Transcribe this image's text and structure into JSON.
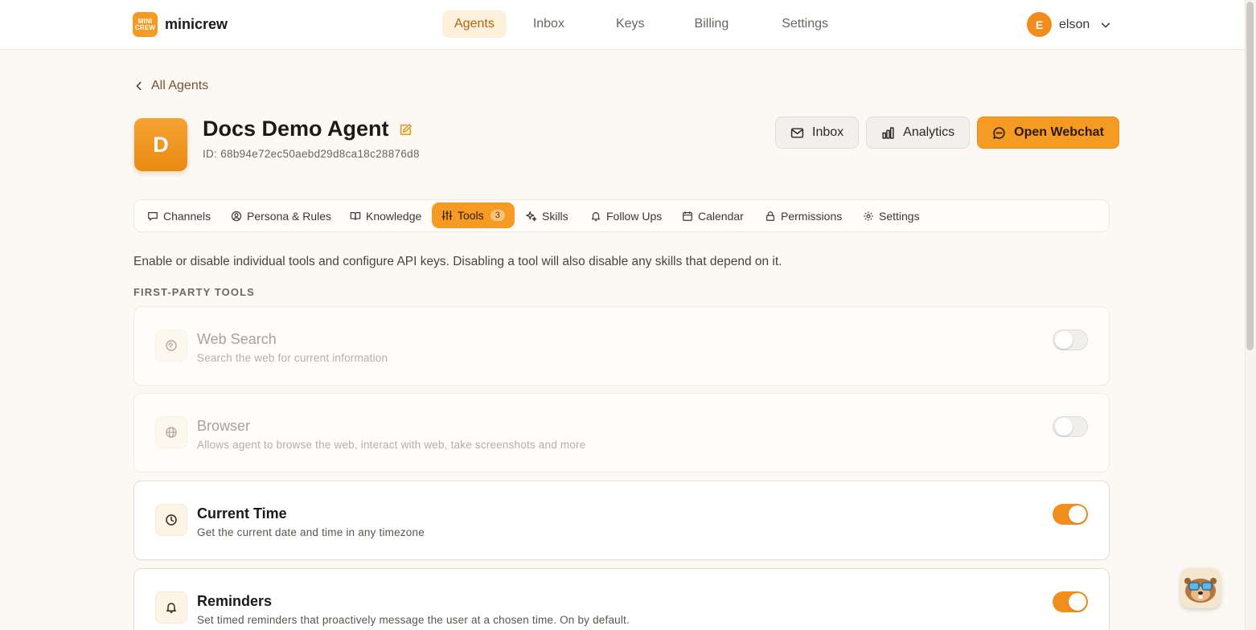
{
  "brand": {
    "logo_line1": "MINI",
    "logo_line2": "CREW",
    "name": "minicrew"
  },
  "nav": [
    {
      "label": "Agents",
      "active": true
    },
    {
      "label": "Inbox",
      "active": false
    },
    {
      "label": "Keys",
      "active": false
    },
    {
      "label": "Billing",
      "active": false
    },
    {
      "label": "Settings",
      "active": false
    }
  ],
  "user": {
    "initial": "E",
    "name": "elson"
  },
  "back_link": "All Agents",
  "agent": {
    "initial": "D",
    "name": "Docs Demo Agent",
    "id_text": "ID: 68b94e72ec50aebd29d8ca18c28876d8"
  },
  "actions": {
    "inbox": "Inbox",
    "analytics": "Analytics",
    "webchat": "Open Webchat"
  },
  "tabs": [
    {
      "label": "Channels",
      "icon": "chat-icon"
    },
    {
      "label": "Persona & Rules",
      "icon": "user-circle-icon"
    },
    {
      "label": "Knowledge",
      "icon": "book-icon"
    },
    {
      "label": "Tools",
      "icon": "sliders-icon",
      "badge": "3",
      "active": true
    },
    {
      "label": "Skills",
      "icon": "sparkle-icon"
    },
    {
      "label": "Follow Ups",
      "icon": "bell-icon"
    },
    {
      "label": "Calendar",
      "icon": "calendar-icon"
    },
    {
      "label": "Permissions",
      "icon": "lock-icon"
    },
    {
      "label": "Settings",
      "icon": "gear-icon"
    }
  ],
  "intro": "Enable or disable individual tools and configure API keys. Disabling a tool will also disable any skills that depend on it.",
  "section_title": "FIRST-PARTY TOOLS",
  "tools": [
    {
      "name": "Web Search",
      "desc": "Search the web for current information",
      "enabled": false,
      "icon": "search-icon"
    },
    {
      "name": "Browser",
      "desc": "Allows agent to browse the web, interact with web, take screenshots and more",
      "enabled": false,
      "icon": "globe-icon"
    },
    {
      "name": "Current Time",
      "desc": "Get the current date and time in any timezone",
      "enabled": true,
      "icon": "clock-icon"
    },
    {
      "name": "Reminders",
      "desc": "Set timed reminders that proactively message the user at a chosen time. On by default.",
      "enabled": true,
      "icon": "bell-icon"
    }
  ],
  "colors": {
    "accent": "#f59a22",
    "background": "#fcf9f4",
    "active_nav_bg": "#fdf1dc"
  }
}
